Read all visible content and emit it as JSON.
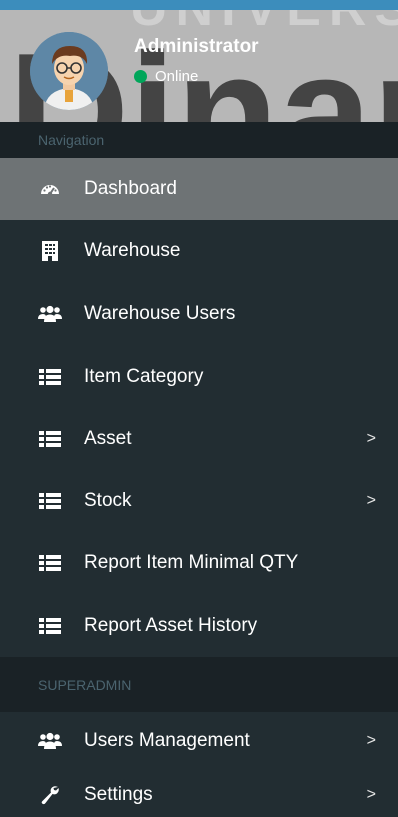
{
  "watermark": {
    "top_text": "UNIVERS",
    "big_text": "Dinar"
  },
  "user": {
    "name": "Administrator",
    "status": "Online",
    "status_color": "#00a65a"
  },
  "sections": {
    "navigation": "Navigation",
    "superadmin": "SUPERADMIN"
  },
  "menu": {
    "dashboard": {
      "label": "Dashboard",
      "icon": "dashboard-icon"
    },
    "warehouse": {
      "label": "Warehouse",
      "icon": "building-icon"
    },
    "warehouse_users": {
      "label": "Warehouse Users",
      "icon": "users-icon"
    },
    "item_category": {
      "label": "Item Category",
      "icon": "list-icon"
    },
    "asset": {
      "label": "Asset",
      "icon": "list-icon",
      "chevron": ">"
    },
    "stock": {
      "label": "Stock",
      "icon": "list-icon",
      "chevron": ">"
    },
    "report_minimal": {
      "label": "Report Item Minimal QTY",
      "icon": "list-icon"
    },
    "report_asset": {
      "label": "Report Asset History",
      "icon": "list-icon"
    },
    "users_management": {
      "label": "Users Management",
      "icon": "users-icon",
      "chevron": ">"
    },
    "settings": {
      "label": "Settings",
      "icon": "wrench-icon",
      "chevron": ">"
    }
  },
  "colors": {
    "sidebar_bg": "#222d32",
    "header_bg": "#1a2226",
    "active_bg": "#6e7375",
    "accent": "#3c8dbc"
  }
}
